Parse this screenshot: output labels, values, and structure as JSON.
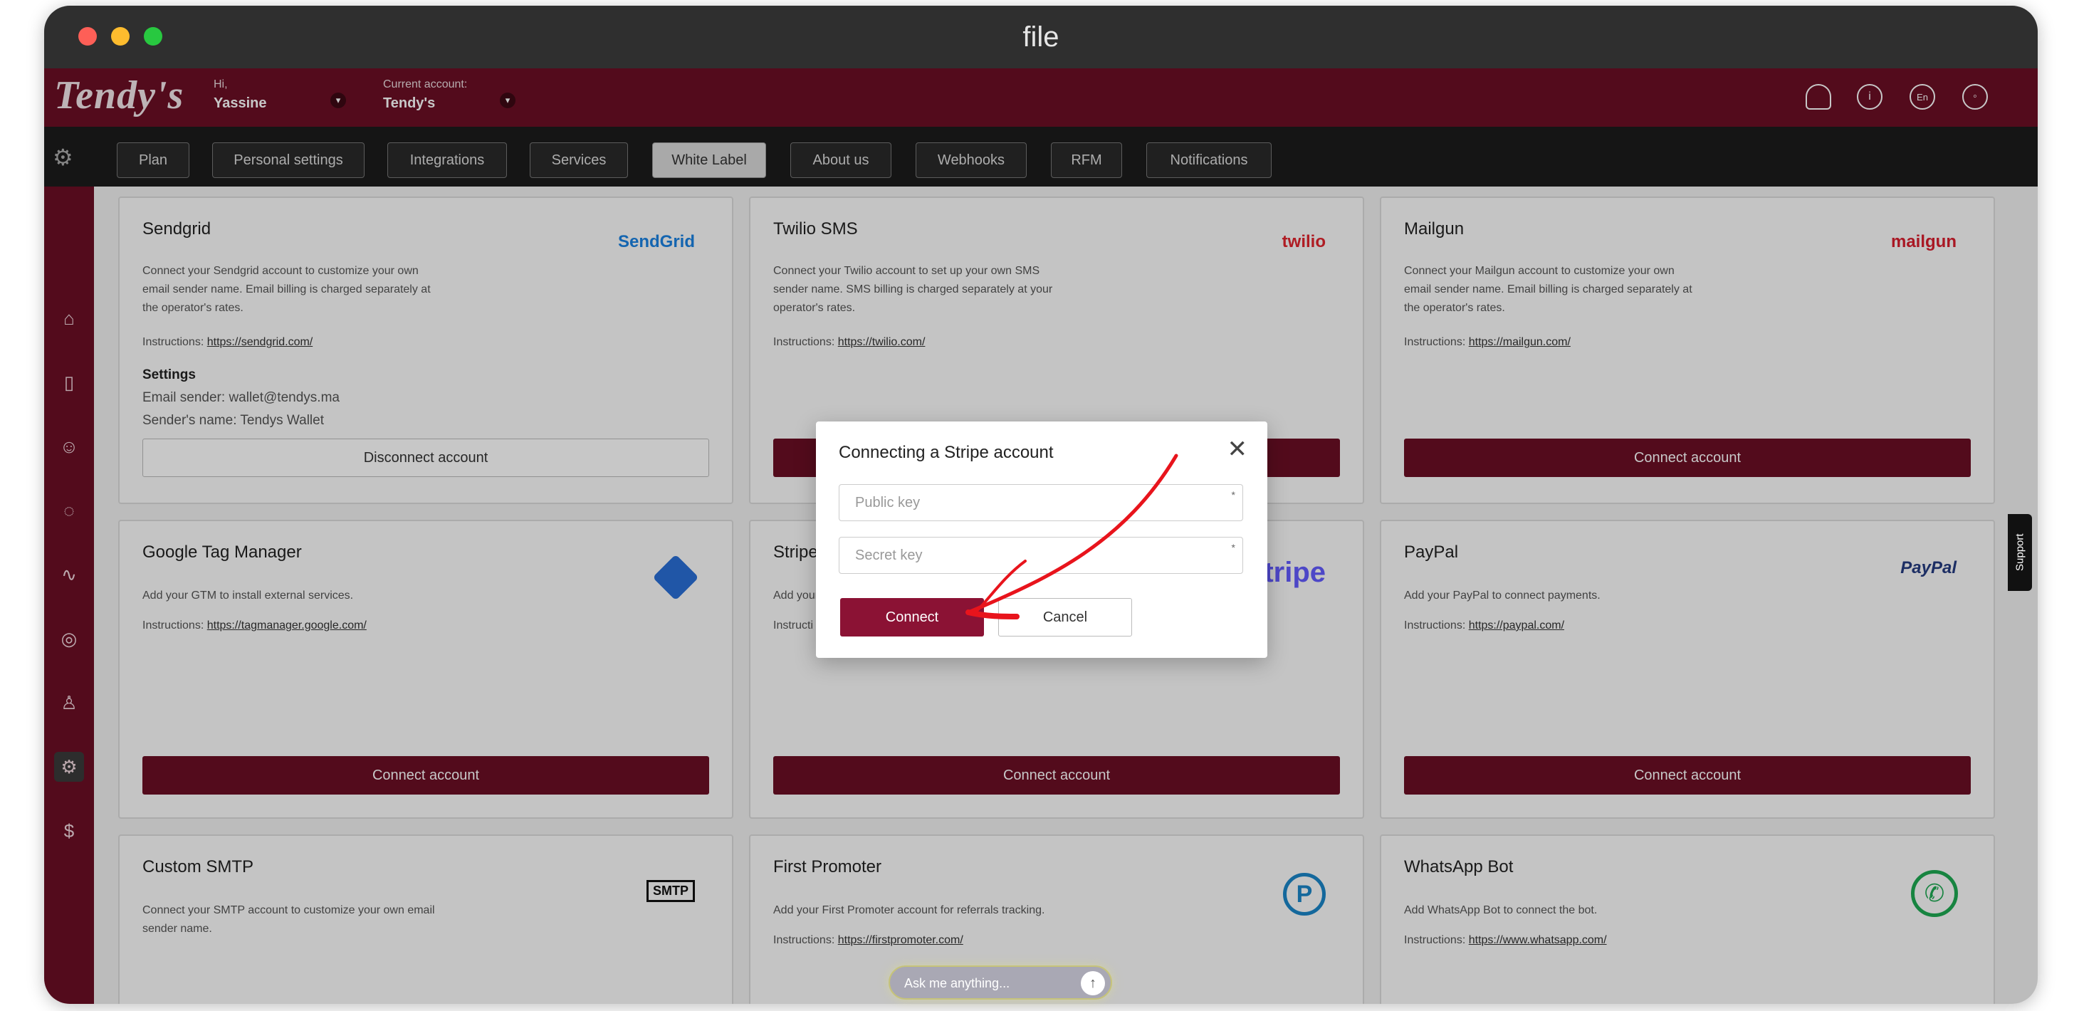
{
  "window": {
    "title": "file"
  },
  "topbar": {
    "logo": "Tendy's",
    "greeting": "Hi,",
    "user": "Yassine",
    "account_label": "Current account:",
    "account": "Tendy's",
    "icons": [
      "bell-icon",
      "info-icon",
      "language-icon",
      "user-circle-icon"
    ],
    "language": "En"
  },
  "nav": {
    "tabs": [
      "Plan",
      "Personal settings",
      "Integrations",
      "Services",
      "White Label",
      "About us",
      "Webhooks",
      "RFM",
      "Notifications"
    ],
    "active": "White Label"
  },
  "sidebar": {
    "icons": [
      "home-icon",
      "device-icon",
      "users-icon",
      "chat-icon",
      "route-icon",
      "location-icon",
      "profile-icon",
      "settings-icon",
      "dollar-icon"
    ],
    "active": "settings-icon"
  },
  "cards": {
    "sendgrid": {
      "title": "Sendgrid",
      "desc": "Connect your Sendgrid account to customize your own email sender name. Email billing is charged separately at the operator's rates.",
      "instr_label": "Instructions:",
      "instr_link": "https://sendgrid.com/",
      "brand": "SendGrid",
      "settings_title": "Settings",
      "sender_email": "Email sender: wallet@tendys.ma",
      "sender_name": "Sender's name: Tendys Wallet",
      "button": "Disconnect account"
    },
    "twilio": {
      "title": "Twilio SMS",
      "desc": "Connect your Twilio account to set up your own SMS sender name. SMS billing is charged separately at your operator's rates.",
      "instr_label": "Instructions:",
      "instr_link": "https://twilio.com/",
      "brand": "twilio"
    },
    "mailgun": {
      "title": "Mailgun",
      "desc": "Connect your Mailgun account to customize your own email sender name. Email billing is charged separately at the operator's rates.",
      "instr_label": "Instructions:",
      "instr_link": "https://mailgun.com/",
      "brand": "mailgun",
      "button": "Connect account"
    },
    "gtm": {
      "title": "Google Tag Manager",
      "desc": "Add your GTM to install external services.",
      "instr_label": "Instructions:",
      "instr_link": "https://tagmanager.google.com/",
      "button": "Connect account"
    },
    "stripe": {
      "title": "Stripe",
      "desc": "Add your",
      "instr_label": "Instructi",
      "brand": "tripe",
      "button": "Connect account"
    },
    "paypal": {
      "title": "PayPal",
      "desc": "Add your PayPal to connect payments.",
      "instr_label": "Instructions:",
      "instr_link": "https://paypal.com/",
      "brand": "PayPal",
      "button": "Connect account"
    },
    "smtp": {
      "title": "Custom SMTP",
      "desc": "Connect your SMTP account to customize your own email sender name.",
      "brand": "SMTP"
    },
    "firstpromoter": {
      "title": "First Promoter",
      "desc": "Add your First Promoter account for referrals tracking.",
      "instr_label": "Instructions:",
      "instr_link": "https://firstpromoter.com/"
    },
    "whatsapp": {
      "title": "WhatsApp Bot",
      "desc": "Add WhatsApp Bot to connect the bot.",
      "instr_label": "Instructions:",
      "instr_link": "https://www.whatsapp.com/"
    }
  },
  "modal": {
    "title": "Connecting a Stripe account",
    "public_key_placeholder": "Public key",
    "secret_key_placeholder": "Secret key",
    "required_mark": "*",
    "connect": "Connect",
    "cancel": "Cancel"
  },
  "ask": {
    "placeholder": "Ask me anything..."
  },
  "support": {
    "label": "Support"
  },
  "colors": {
    "brand": "#6b0f25",
    "annotation": "#e8141c"
  }
}
